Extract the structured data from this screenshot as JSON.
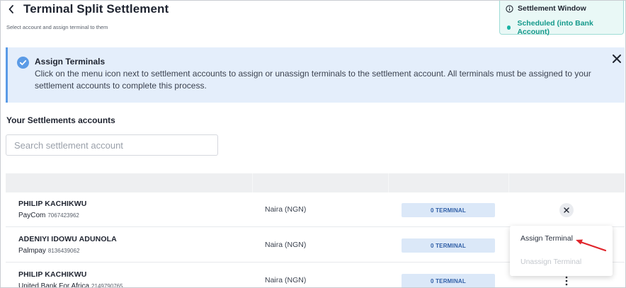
{
  "header": {
    "title": "Terminal Split Settlement",
    "subtitle": "Select account and assign terminal to them"
  },
  "settlement_window": {
    "title": "Settlement Window",
    "status": "Scheduled (into Bank Account)"
  },
  "banner": {
    "title": "Assign Terminals",
    "body": "Click on the menu icon next to settlement accounts to assign or unassign terminals to the settlement account. All terminals must be assigned to your settlement accounts to complete this process."
  },
  "section": {
    "title": "Your Settlements accounts"
  },
  "search": {
    "placeholder": "Search settlement account",
    "value": ""
  },
  "rows": [
    {
      "name": "PHILIP KACHIKWU",
      "bank": "PayCom",
      "account_number": "7067423962",
      "currency": "Naira (NGN)",
      "terminals": "0 TERMINAL"
    },
    {
      "name": "ADENIYI IDOWU ADUNOLA",
      "bank": "Palmpay",
      "account_number": "8136439062",
      "currency": "Naira (NGN)",
      "terminals": "0 TERMINAL"
    },
    {
      "name": "PHILIP KACHIKWU",
      "bank": "United Bank For Africa",
      "account_number": "2149790765",
      "currency": "Naira (NGN)",
      "terminals": "0 TERMINAL"
    }
  ],
  "menu": {
    "assign_label": "Assign Terminal",
    "unassign_label": "Unassign Terminal"
  },
  "colors": {
    "accent_teal": "#19b3a4",
    "banner_bg": "#e4eefb",
    "badge_bg": "#dbe8f8",
    "annotation_red": "#e0242b"
  }
}
